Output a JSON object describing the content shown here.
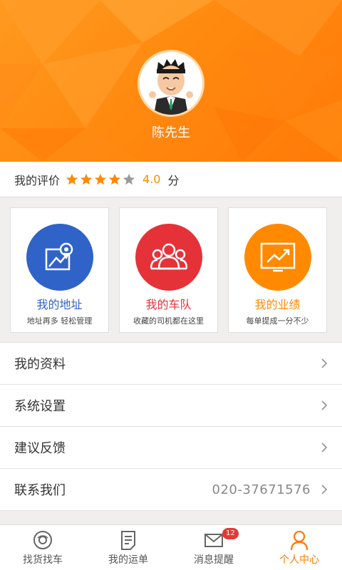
{
  "profile": {
    "name": "陈先生"
  },
  "rating": {
    "label": "我的评价",
    "stars_filled": 4,
    "stars_total": 5,
    "value": "4.0",
    "unit": "分"
  },
  "cards": [
    {
      "title": "我的地址",
      "subtitle": "地址再多 轻松管理",
      "color": "#2f63c8",
      "icon": "map-pin-icon"
    },
    {
      "title": "我的车队",
      "subtitle": "收藏的司机都在这里",
      "color": "#e53238",
      "icon": "team-icon"
    },
    {
      "title": "我的业绩",
      "subtitle": "每单提成一分不少",
      "color": "#ff8a00",
      "icon": "trend-chart-icon"
    }
  ],
  "menu": [
    {
      "label": "我的资料",
      "value": ""
    },
    {
      "label": "系统设置",
      "value": ""
    },
    {
      "label": "建议反馈",
      "value": ""
    },
    {
      "label": "联系我们",
      "value": "020-37671576"
    }
  ],
  "tabs": [
    {
      "label": "找货找车",
      "icon": "search-cargo-icon"
    },
    {
      "label": "我的运单",
      "icon": "waybill-icon"
    },
    {
      "label": "消息提醒",
      "icon": "mail-icon",
      "badge": "12"
    },
    {
      "label": "个人中心",
      "icon": "person-icon",
      "active": true
    }
  ],
  "colors": {
    "brand": "#ff8a00",
    "active_tab": "#ff7a00",
    "badge": "#e53935"
  }
}
